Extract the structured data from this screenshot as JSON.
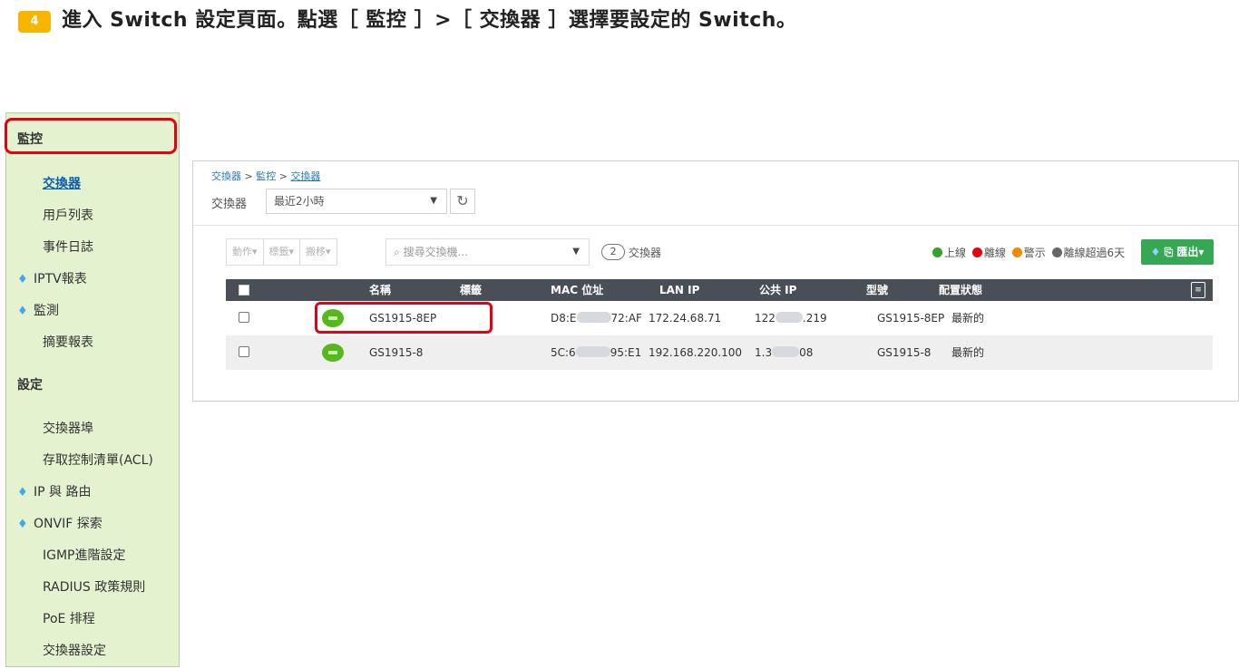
{
  "instruction": {
    "step": "4",
    "text": "進入 Switch 設定頁面。點選［ 監控 ］>［ 交換器 ］選擇要設定的 Switch。"
  },
  "sidebar": {
    "sections": [
      {
        "label": "監控",
        "type": "head"
      },
      {
        "label": "交換器",
        "type": "sub",
        "active": true
      },
      {
        "label": "用戶列表",
        "type": "sub"
      },
      {
        "label": "事件日誌",
        "type": "sub"
      },
      {
        "label": "IPTV報表",
        "type": "gem"
      },
      {
        "label": "監測",
        "type": "gem"
      },
      {
        "label": "摘要報表",
        "type": "sub"
      },
      {
        "label": "設定",
        "type": "head"
      },
      {
        "label": "交換器埠",
        "type": "sub"
      },
      {
        "label": "存取控制清單(ACL)",
        "type": "sub"
      },
      {
        "label": "IP 與 路由",
        "type": "gem"
      },
      {
        "label": "ONVIF 探索",
        "type": "gem"
      },
      {
        "label": "IGMP進階設定",
        "type": "sub"
      },
      {
        "label": "RADIUS 政策規則",
        "type": "sub"
      },
      {
        "label": "PoE 排程",
        "type": "sub"
      },
      {
        "label": "交換器設定",
        "type": "sub"
      }
    ]
  },
  "breadcrumb": {
    "part1": "交換器",
    "part2": "監控",
    "current": "交換器",
    "sep": ">"
  },
  "filter": {
    "label": "交換器",
    "time_range": "最近2小時"
  },
  "toolbar": {
    "actions": [
      "動作▾",
      "標籤▾",
      "搬移▾"
    ],
    "search_placeholder": "搜尋交換機...",
    "count": "2",
    "count_label": "交換器",
    "export_label": "匯出▾"
  },
  "legend": [
    {
      "label": "上線",
      "color": "#34a32a"
    },
    {
      "label": "離線",
      "color": "#e60012"
    },
    {
      "label": "警示",
      "color": "#f08a00"
    },
    {
      "label": "離線超過6天",
      "color": "#666666"
    }
  ],
  "table": {
    "columns": [
      "名稱",
      "標籤",
      "MAC 位址",
      "LAN IP",
      "公共 IP",
      "型號",
      "配置狀態"
    ],
    "rows": [
      {
        "name": "GS1915-8EP",
        "tag": "",
        "mac_a": "D8:E",
        "mac_b": "72:AF",
        "lan_ip": "172.24.68.71",
        "pub_a": "122",
        "pub_b": ".219",
        "model": "GS1915-8EP",
        "config": "最新的"
      },
      {
        "name": "GS1915-8",
        "tag": "",
        "mac_a": "5C:6",
        "mac_b": "95:E1",
        "lan_ip": "192.168.220.100",
        "pub_a": "1.3",
        "pub_b": "08",
        "model": "GS1915-8",
        "config": "最新的"
      }
    ]
  }
}
